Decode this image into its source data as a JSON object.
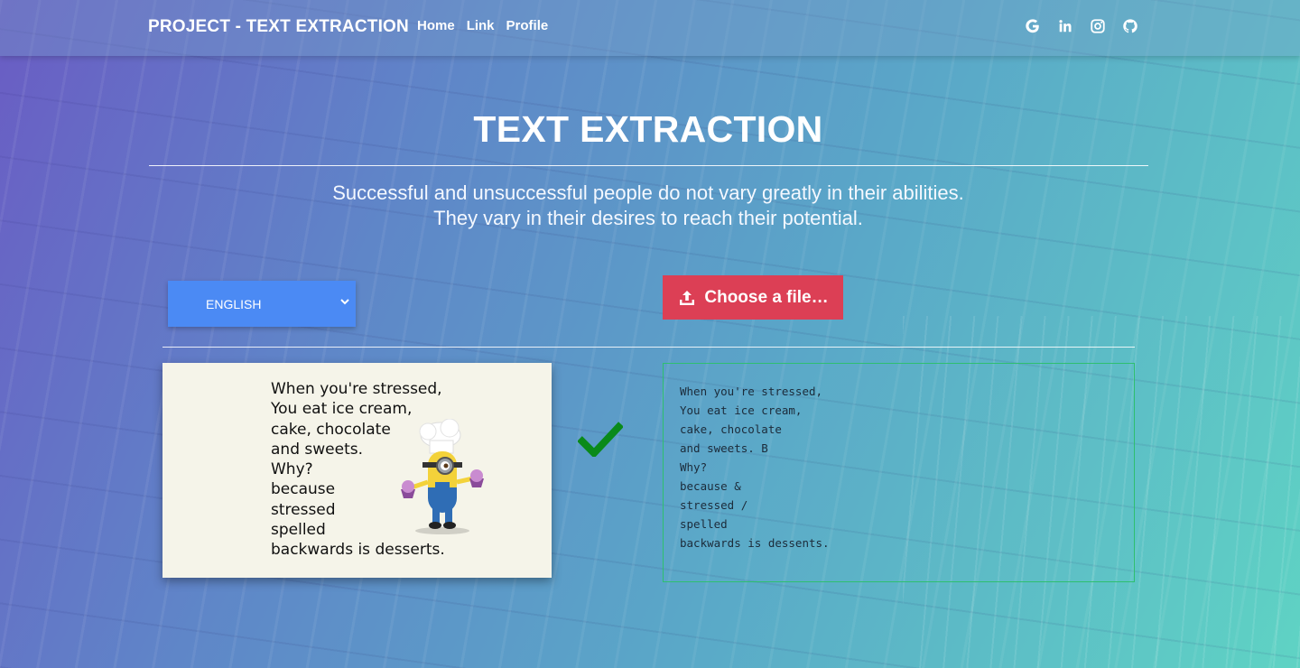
{
  "navbar": {
    "brand": "PROJECT - TEXT EXTRACTION",
    "links": [
      "Home",
      "Link",
      "Profile"
    ],
    "social_icons": [
      "google-icon",
      "linkedin-icon",
      "instagram-icon",
      "github-icon"
    ]
  },
  "hero": {
    "title": "TEXT EXTRACTION",
    "quote_line1": "Successful and unsuccessful people do not vary greatly in their abilities.",
    "quote_line2": "They vary in their desires to reach their potential."
  },
  "controls": {
    "language_selected": "ENGLISH",
    "upload_label": "Choose a file…"
  },
  "image_card": {
    "lines": [
      "When you're stressed,",
      "You eat ice cream,",
      "cake, chocolate",
      "and sweets.",
      "Why?",
      "because",
      "stressed",
      "spelled",
      "backwards is desserts."
    ]
  },
  "output": {
    "lines": [
      "When you're stressed,",
      "You eat ice cream,",
      "cake, chocolate",
      "and sweets. B",
      "Why?",
      "because &",
      "stressed /",
      "spelled",
      "backwards is dessents."
    ]
  },
  "colors": {
    "select_bg": "#4b8af4",
    "upload_bg": "#dc3f55",
    "check": "#0a8a1a",
    "output_border": "#2ebf6f"
  }
}
